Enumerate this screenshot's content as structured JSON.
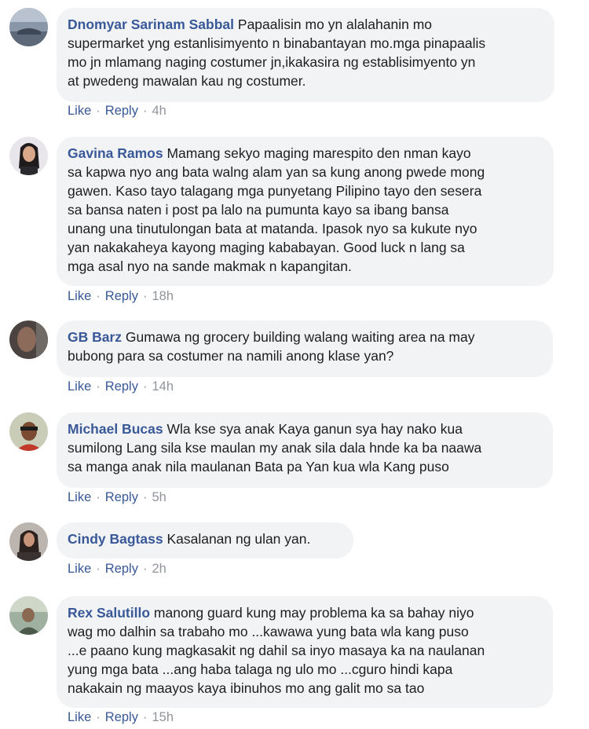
{
  "actions": {
    "like": "Like",
    "reply": "Reply",
    "separator": "·"
  },
  "comments": [
    {
      "author": "Dnomyar Sarinam Sabbal",
      "text": "Papaalisin mo yn alalahanin mo\nsupermarket yng estanlisimyento n binabantayan mo.mga pinapaalis\nmo jn mlamang naging costumer jn,ikakasira ng establisimyento yn\nat pwedeng mawalan kau ng costumer.",
      "time": "4h",
      "avatar_icon": "profile-photo"
    },
    {
      "author": "Gavina Ramos",
      "text": "Mamang sekyo maging marespito den nman kayo\nsa kapwa nyo ang bata walng alam yan sa kung anong pwede mong\ngawen. Kaso tayo talagang mga punyetang Pilipino tayo den sesera\nsa bansa naten i post pa lalo na pumunta kayo sa ibang bansa\nunang una tinutulongan bata at matanda. Ipasok nyo sa kukute nyo\nyan nakakaheya kayong maging kababayan. Good luck n lang sa\nmga asal nyo na sande makmak n kapangitan.",
      "time": "18h",
      "avatar_icon": "profile-photo"
    },
    {
      "author": "GB Barz",
      "text": "Gumawa ng grocery building walang waiting area na may\nbubong para sa costumer na namili anong klase yan?",
      "time": "14h",
      "avatar_icon": "profile-photo"
    },
    {
      "author": "Michael Bucas",
      "text": "Wla kse sya anak Kaya ganun sya hay nako kua\nsumilong Lang sila kse maulan my anak sila dala hnde ka ba naawa\nsa manga anak nila maulanan Bata pa Yan kua wla Kang puso",
      "time": "5h",
      "avatar_icon": "profile-photo"
    },
    {
      "author": "Cindy Bagtass",
      "text": "Kasalanan ng ulan yan.",
      "time": "2h",
      "avatar_icon": "profile-photo"
    },
    {
      "author": "Rex Salutillo",
      "text": "manong guard kung may problema ka sa bahay niyo\nwag mo dalhin sa trabaho mo ...kawawa yung bata wla kang puso\n...e paano kung magkasakit ng dahil sa inyo masaya ka na naulanan\nyung mga bata ...ang haba talaga ng ulo mo ...cguro hindi kapa\nnakakain ng maayos kaya ibinuhos mo ang galit mo sa tao",
      "time": "15h",
      "avatar_icon": "profile-photo"
    }
  ]
}
